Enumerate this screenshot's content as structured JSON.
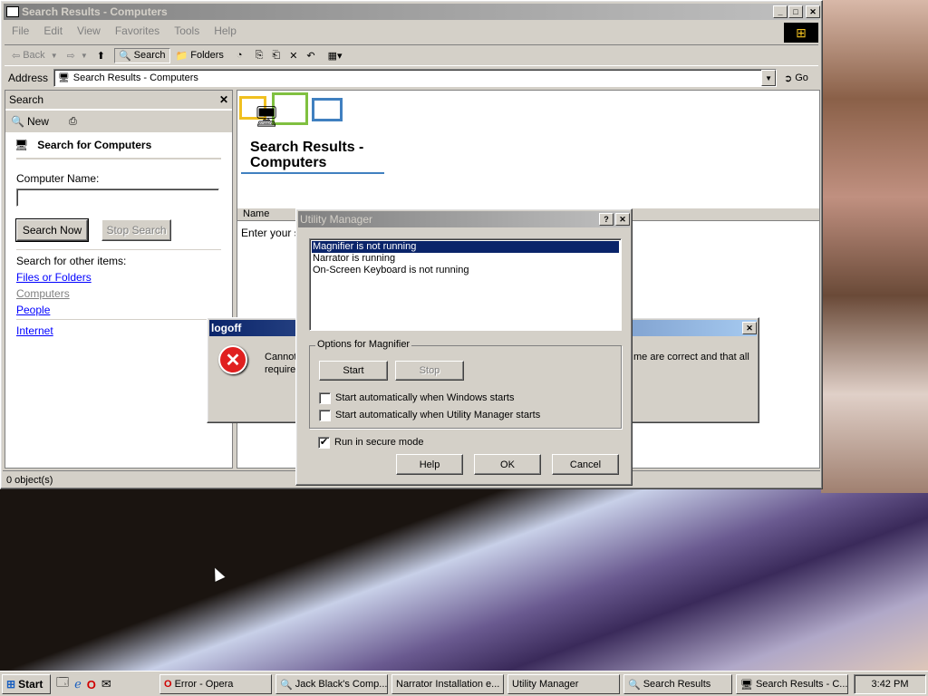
{
  "explorer": {
    "title": "Search Results - Computers",
    "menu": [
      "File",
      "Edit",
      "View",
      "Favorites",
      "Tools",
      "Help"
    ],
    "toolbar": {
      "back": "Back",
      "search": "Search",
      "folders": "Folders"
    },
    "address_label": "Address",
    "address_value": "Search Results - Computers",
    "go_label": "Go",
    "search_pane": {
      "title": "Search",
      "new_label": "New",
      "heading": "Search for Computers",
      "computer_name_label": "Computer Name:",
      "computer_name_value": "",
      "search_now": "Search Now",
      "stop_search": "Stop Search",
      "other_items_label": "Search for other items:",
      "links": [
        "Files or Folders",
        "Computers",
        "People"
      ],
      "internet": "Internet"
    },
    "results_title": "Search Results - Computers",
    "column_name": "Name",
    "results_hint": "Enter your se",
    "status": "0 object(s)"
  },
  "logoff": {
    "title": "logoff",
    "message_left": "Cannot",
    "message_left2": "require",
    "message_right": "me are correct and that all"
  },
  "utility_manager": {
    "title": "Utility Manager",
    "items": [
      "Magnifier is not running",
      "Narrator is running",
      "On-Screen Keyboard is not running"
    ],
    "selected_index": 0,
    "options_label": "Options for Magnifier",
    "start": "Start",
    "stop": "Stop",
    "auto_windows": "Start automatically when Windows starts",
    "auto_windows_checked": false,
    "auto_um": "Start automatically when Utility Manager starts",
    "auto_um_checked": false,
    "secure_mode": "Run in secure mode",
    "secure_mode_checked": true,
    "help": "Help",
    "ok": "OK",
    "cancel": "Cancel"
  },
  "taskbar": {
    "start": "Start",
    "tasks": [
      "Error - Opera",
      "Jack Black's Comp...",
      "Narrator Installation e...",
      "Utility Manager",
      "Search Results",
      "Search Results - C..."
    ],
    "clock": "3:42 PM"
  }
}
